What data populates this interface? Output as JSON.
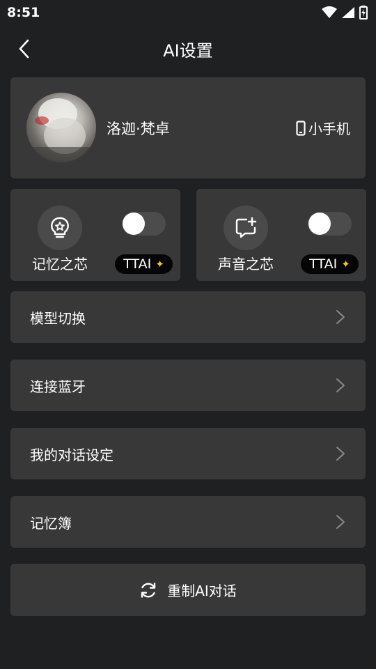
{
  "status_bar": {
    "time": "8:51",
    "icons": [
      "wifi-icon",
      "cellular-signal-icon",
      "battery-icon"
    ]
  },
  "header": {
    "title": "AI设置",
    "back_icon": "chevron-left-icon"
  },
  "profile": {
    "name": "洛迦·梵卓",
    "device_label": "小手机",
    "device_icon": "phone-icon"
  },
  "features": [
    {
      "label": "记忆之芯",
      "icon": "lightbulb-star-icon",
      "toggle_on": false,
      "badge": "TTAI",
      "badge_icon": "sparkle-icon"
    },
    {
      "label": "声音之芯",
      "icon": "chat-bubble-plus-icon",
      "toggle_on": false,
      "badge": "TTAI",
      "badge_icon": "sparkle-icon"
    }
  ],
  "menu": [
    {
      "label": "模型切换"
    },
    {
      "label": "连接蓝牙"
    },
    {
      "label": "我的对话设定"
    },
    {
      "label": "记忆簿"
    }
  ],
  "reset": {
    "label": "重制AI对话",
    "icon": "refresh-icon"
  },
  "colors": {
    "background": "#1f2022",
    "card": "#383838",
    "badge_bg": "#050505",
    "accent_star": "#f5c518"
  }
}
